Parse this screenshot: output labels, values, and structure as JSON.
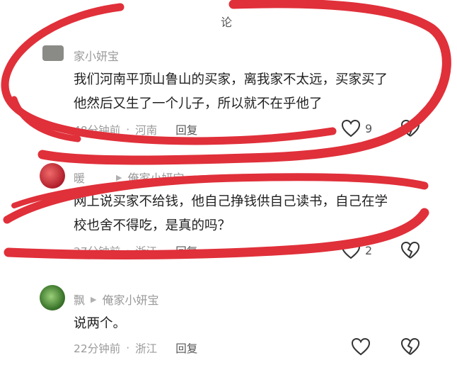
{
  "top_partial": "论",
  "comments": [
    {
      "user": "家小妍宝",
      "lines": [
        "我们河南平顶山鲁山的买家，离我家不太远，买家买了",
        "他然后又生了一个儿子，所以就不在乎他了"
      ],
      "time": "48分钟前",
      "location": "河南",
      "reply": "回复",
      "likes": "9"
    },
    {
      "user": "暖",
      "reply_to": "俺家小妍宝",
      "lines": [
        "网上说买家不给钱，他自己挣钱供自己读书，自己在学",
        "校也舍不得吃，是真的吗？"
      ],
      "time": "27分钟前",
      "location": "浙江",
      "reply": "回复",
      "likes": "2"
    },
    {
      "user": "飘",
      "reply_to": "俺家小妍宝",
      "lines": [
        "说两个。"
      ],
      "time": "22分钟前",
      "location": "浙江",
      "reply": "回复",
      "likes": ""
    }
  ],
  "colors": {
    "scribble": "#e0303a",
    "meta": "#9a9a9a"
  },
  "icons": [
    "heart-icon",
    "broken-heart-icon",
    "triangle-arrow-icon"
  ]
}
